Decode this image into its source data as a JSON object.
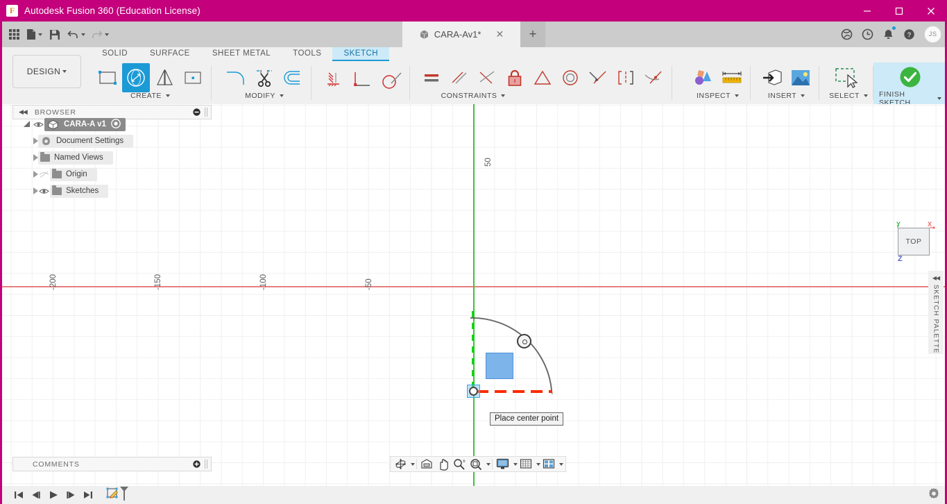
{
  "window": {
    "title": "Autodesk Fusion 360 (Education License)",
    "logo_letter": "F",
    "minimize_icon": "minimize-icon",
    "maximize_icon": "maximize-icon",
    "close_icon": "close-icon",
    "accent_color": "#c4007c"
  },
  "quick_access": {
    "grid_icon": "app-grid-icon",
    "new_label": "new-file-icon",
    "save_label": "save-icon",
    "undo_label": "undo-icon",
    "redo_label": "redo-icon"
  },
  "document_tab": {
    "name": "CARA-Av1*",
    "cube_icon": "document-cube-icon",
    "close_icon": "close-icon",
    "new_tab_icon": "plus-icon"
  },
  "account_bar": {
    "extensions_icon": "extensions-icon",
    "job_status_icon": "clock-icon",
    "notifications_icon": "bell-icon",
    "help_icon": "help-icon",
    "avatar_initials": "JS"
  },
  "ribbon": {
    "workspace_label": "DESIGN",
    "tabs": [
      {
        "label": "SOLID",
        "active": false
      },
      {
        "label": "SURFACE",
        "active": false
      },
      {
        "label": "SHEET METAL",
        "active": false
      },
      {
        "label": "TOOLS",
        "active": false
      },
      {
        "label": "SKETCH",
        "active": true
      }
    ],
    "panels": [
      {
        "label": "CREATE",
        "has_dropdown": true,
        "icons": [
          {
            "name": "rectangle-icon",
            "selected": false
          },
          {
            "name": "circle-icon",
            "selected": true
          },
          {
            "name": "line-mirror-icon",
            "selected": false
          },
          {
            "name": "point-icon",
            "selected": false
          }
        ]
      },
      {
        "label": "MODIFY",
        "has_dropdown": true,
        "icons": [
          {
            "name": "fillet-icon",
            "selected": false
          },
          {
            "name": "trim-icon",
            "selected": false
          },
          {
            "name": "offset-icon",
            "selected": false
          }
        ]
      },
      {
        "label": "",
        "has_dropdown": false,
        "icons": [
          {
            "name": "sketch-dimension-icon",
            "selected": false
          },
          {
            "name": "construction-line-icon",
            "selected": false
          },
          {
            "name": "slice-icon",
            "selected": false
          }
        ]
      },
      {
        "label": "CONSTRAINTS",
        "has_dropdown": true,
        "icons": [
          {
            "name": "horizontal-vertical-constraint-icon",
            "selected": false
          },
          {
            "name": "parallel-constraint-icon",
            "selected": false
          },
          {
            "name": "perpendicular-constraint-icon",
            "selected": false
          },
          {
            "name": "fix-unfix-constraint-icon",
            "selected": false
          },
          {
            "name": "equal-constraint-icon",
            "selected": false
          },
          {
            "name": "concentric-constraint-icon",
            "selected": false
          },
          {
            "name": "tangent-constraint-icon",
            "selected": false
          },
          {
            "name": "symmetry-constraint-icon",
            "selected": false
          },
          {
            "name": "curvature-constraint-icon",
            "selected": false
          }
        ]
      },
      {
        "label": "INSPECT",
        "has_dropdown": true,
        "icons": [
          {
            "name": "interference-icon",
            "selected": false
          },
          {
            "name": "measure-icon",
            "selected": false
          }
        ]
      },
      {
        "label": "INSERT",
        "has_dropdown": true,
        "icons": [
          {
            "name": "insert-derive-icon",
            "selected": false
          },
          {
            "name": "insert-canvas-icon",
            "selected": false
          }
        ]
      },
      {
        "label": "SELECT",
        "has_dropdown": true,
        "icons": [
          {
            "name": "select-window-icon",
            "selected": false
          }
        ]
      },
      {
        "label": "FINISH SKETCH",
        "has_dropdown": true,
        "highlight": true,
        "icons": [
          {
            "name": "finish-sketch-check-icon",
            "selected": false
          }
        ]
      }
    ]
  },
  "browser": {
    "title": "BROWSER",
    "collapse_icon": "collapse-left-icon",
    "minus_icon": "minus-circle-icon",
    "tree": [
      {
        "label": "CARA-A v1",
        "level": 0,
        "icon": "component-cube-icon",
        "eye": "visible",
        "expanded": true,
        "has_radio": true
      },
      {
        "label": "Document Settings",
        "level": 1,
        "icon": "gear-icon",
        "eye": "none",
        "expanded": false
      },
      {
        "label": "Named Views",
        "level": 1,
        "icon": "folder-icon",
        "eye": "none",
        "expanded": false
      },
      {
        "label": "Origin",
        "level": 1,
        "icon": "folder-icon",
        "eye": "hidden",
        "expanded": false
      },
      {
        "label": "Sketches",
        "level": 1,
        "icon": "folder-icon",
        "eye": "visible",
        "expanded": false
      }
    ]
  },
  "canvas": {
    "ruler_labels": [
      "-200",
      "-150",
      "-100",
      "-50"
    ],
    "y_label": "50",
    "tooltip": "Place center point",
    "x_axis_color": "#e87f7f",
    "y_axis_color": "#3ec23e",
    "preview_fill": "#7db4ea",
    "construction_dash_x_color": "#fd2b00",
    "construction_dash_y_color": "#19d019"
  },
  "view_cube": {
    "face_label": "TOP",
    "axis_x": "X",
    "axis_y": "Y",
    "axis_z": "Z"
  },
  "sketch_palette": {
    "title": "SKETCH PALETTE",
    "collapse_icon": "collapse-right-icon"
  },
  "nav_bar": {
    "items": [
      {
        "name": "orbit-icon",
        "dropdown": true
      },
      {
        "name": "look-at-icon",
        "dropdown": false
      },
      {
        "name": "pan-icon",
        "dropdown": false
      },
      {
        "name": "zoom-icon",
        "dropdown": false
      },
      {
        "name": "zoom-window-icon",
        "dropdown": true
      },
      {
        "name": "display-settings-icon",
        "dropdown": true
      },
      {
        "name": "grid-snaps-icon",
        "dropdown": true
      },
      {
        "name": "viewports-icon",
        "dropdown": true
      }
    ]
  },
  "comments": {
    "title": "COMMENTS",
    "add_icon": "plus-circle-icon"
  },
  "timeline": {
    "buttons": [
      {
        "name": "go-to-beginning-icon"
      },
      {
        "name": "step-back-icon"
      },
      {
        "name": "play-icon"
      },
      {
        "name": "step-forward-icon"
      },
      {
        "name": "go-to-end-icon"
      }
    ],
    "feature_icon": "sketch-feature-icon",
    "settings_icon": "gear-icon"
  }
}
